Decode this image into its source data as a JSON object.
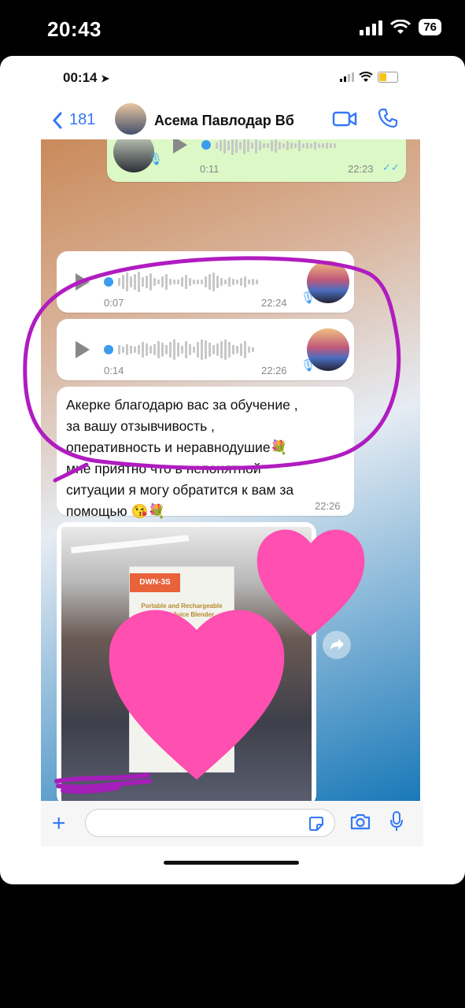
{
  "outer_status": {
    "time": "20:43",
    "battery": "76"
  },
  "inner_status": {
    "time": "00:14"
  },
  "header": {
    "back_count": "181",
    "contact_name": "Асема Павлодар Вб"
  },
  "messages": [
    {
      "type": "voice",
      "direction": "outgoing",
      "duration": "0:11",
      "time": "22:23"
    },
    {
      "type": "voice",
      "direction": "incoming",
      "duration": "0:07",
      "time": "22:24"
    },
    {
      "type": "voice",
      "direction": "incoming",
      "duration": "0:14",
      "time": "22:26"
    },
    {
      "type": "text",
      "direction": "incoming",
      "text": "Акерке благодарю вас за обучение ,\nза вашу отзывчивость ,\nоперативность и неравнодушие💐\nмне приятно что в непонятной\nситуации я могу обратится к вам за\nпомощью 😘💐",
      "time": "22:26"
    },
    {
      "type": "photo",
      "direction": "incoming",
      "box_brand": "DWN-3S",
      "box_title": "Portable and Rechargeable Battery Juice Blender"
    }
  ],
  "icons": [
    "back-chevron-icon",
    "video-call-icon",
    "phone-icon",
    "play-icon",
    "mic-icon",
    "forward-icon",
    "scroll-down-icon",
    "plus-icon",
    "sticker-icon",
    "camera-icon",
    "microphone-icon"
  ],
  "colors": {
    "accent": "#3478f6",
    "outgoing_bubble": "#dcf8c6",
    "annotation": "#b01cc0",
    "heart": "#ff4fb0"
  }
}
